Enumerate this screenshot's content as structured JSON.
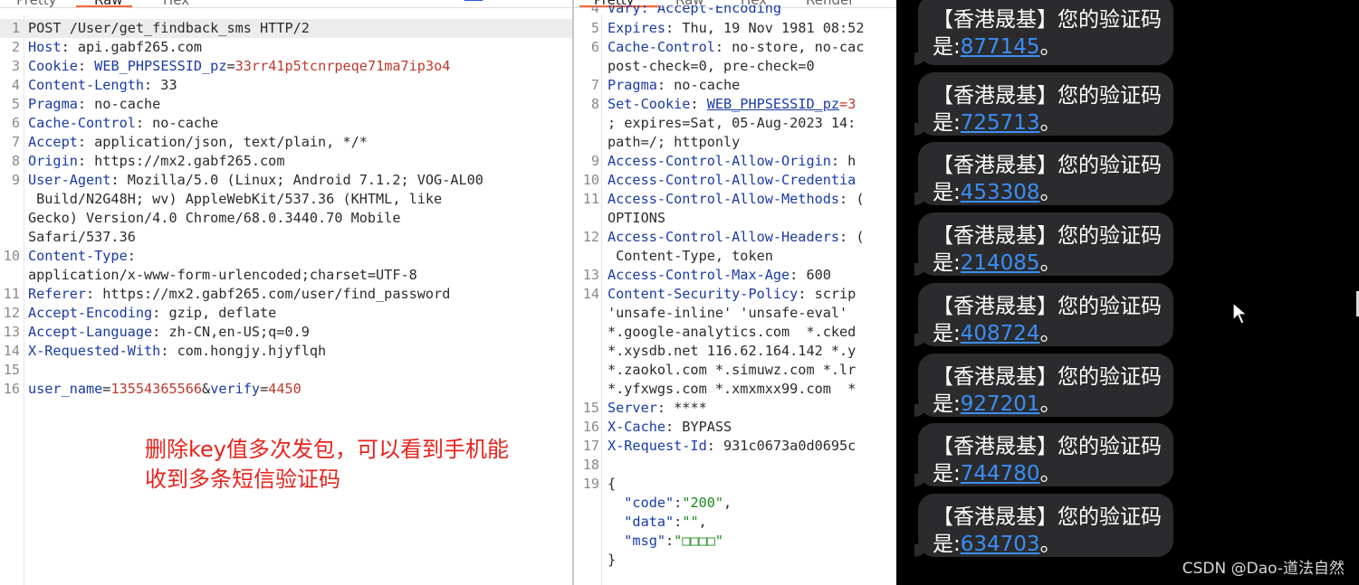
{
  "request": {
    "tabs": [
      "Pretty",
      "Raw",
      "Hex"
    ],
    "active_tab": "Raw",
    "top_icons": [
      "ln-icon",
      "wrap-icon",
      "menu-icon"
    ],
    "lines": [
      {
        "n": "1",
        "segs": [
          {
            "t": "POST /User/get_findback_sms HTTP/2",
            "c": "v"
          }
        ]
      },
      {
        "n": "2",
        "segs": [
          {
            "t": "Host",
            "c": "k"
          },
          {
            "t": ": api.gabf265.com",
            "c": "v"
          }
        ]
      },
      {
        "n": "3",
        "segs": [
          {
            "t": "Cookie",
            "c": "k"
          },
          {
            "t": ": ",
            "c": "v"
          },
          {
            "t": "WEB_PHPSESSID_pz",
            "c": "k"
          },
          {
            "t": "=",
            "c": "v"
          },
          {
            "t": "33rr41p5tcnrpeqe71ma7ip3o4",
            "c": "red"
          }
        ]
      },
      {
        "n": "4",
        "segs": [
          {
            "t": "Content-Length",
            "c": "k"
          },
          {
            "t": ": 33",
            "c": "v"
          }
        ]
      },
      {
        "n": "5",
        "segs": [
          {
            "t": "Pragma",
            "c": "k"
          },
          {
            "t": ": no-cache",
            "c": "v"
          }
        ]
      },
      {
        "n": "6",
        "segs": [
          {
            "t": "Cache-Control",
            "c": "k"
          },
          {
            "t": ": no-cache",
            "c": "v"
          }
        ]
      },
      {
        "n": "7",
        "segs": [
          {
            "t": "Accept",
            "c": "k"
          },
          {
            "t": ": application/json, text/plain, */*",
            "c": "v"
          }
        ]
      },
      {
        "n": "8",
        "segs": [
          {
            "t": "Origin",
            "c": "k"
          },
          {
            "t": ": https://mx2.gabf265.com",
            "c": "v"
          }
        ]
      },
      {
        "n": "9",
        "segs": [
          {
            "t": "User-Agent",
            "c": "k"
          },
          {
            "t": ": Mozilla/5.0 (Linux; Android 7.1.2; VOG-AL00",
            "c": "v"
          }
        ]
      },
      {
        "n": "",
        "segs": [
          {
            "t": " Build/N2G48H; wv) AppleWebKit/537.36 (KHTML, like",
            "c": "v"
          }
        ]
      },
      {
        "n": "",
        "segs": [
          {
            "t": "Gecko) Version/4.0 Chrome/68.0.3440.70 Mobile",
            "c": "v"
          }
        ]
      },
      {
        "n": "",
        "segs": [
          {
            "t": "Safari/537.36",
            "c": "v"
          }
        ]
      },
      {
        "n": "10",
        "segs": [
          {
            "t": "Content-Type",
            "c": "k"
          },
          {
            "t": ":",
            "c": "v"
          }
        ]
      },
      {
        "n": "",
        "segs": [
          {
            "t": "application/x-www-form-urlencoded;charset=UTF-8",
            "c": "v"
          }
        ]
      },
      {
        "n": "11",
        "segs": [
          {
            "t": "Referer",
            "c": "k"
          },
          {
            "t": ": https://mx2.gabf265.com/user/find_password",
            "c": "v"
          }
        ]
      },
      {
        "n": "12",
        "segs": [
          {
            "t": "Accept-Encoding",
            "c": "k"
          },
          {
            "t": ": gzip, deflate",
            "c": "v"
          }
        ]
      },
      {
        "n": "13",
        "segs": [
          {
            "t": "Accept-Language",
            "c": "k"
          },
          {
            "t": ": zh-CN,en-US;q=0.9",
            "c": "v"
          }
        ]
      },
      {
        "n": "14",
        "segs": [
          {
            "t": "X-Requested-With",
            "c": "k"
          },
          {
            "t": ": com.hongjy.hjyflqh",
            "c": "v"
          }
        ]
      },
      {
        "n": "15",
        "segs": []
      },
      {
        "n": "16",
        "segs": [
          {
            "t": "user_name",
            "c": "k"
          },
          {
            "t": "=",
            "c": "v"
          },
          {
            "t": "13554365566",
            "c": "red"
          },
          {
            "t": "&",
            "c": "v"
          },
          {
            "t": "verify",
            "c": "k"
          },
          {
            "t": "=",
            "c": "v"
          },
          {
            "t": "4450",
            "c": "red"
          }
        ]
      }
    ],
    "annotation_line1": "删除key值多次发包，可以看到手机能",
    "annotation_line2": "收到多条短信验证码"
  },
  "response": {
    "tabs": [
      "Pretty",
      "Raw",
      "Hex",
      "Render"
    ],
    "active_tab": "Pretty",
    "top_partial": "Vary: Accept-Encoding",
    "lines": [
      {
        "n": "5",
        "segs": [
          {
            "t": "Expires",
            "c": "k"
          },
          {
            "t": ": Thu, 19 Nov 1981 08:52",
            "c": "v"
          }
        ]
      },
      {
        "n": "6",
        "segs": [
          {
            "t": "Cache-Control",
            "c": "k"
          },
          {
            "t": ": no-store, no-cac",
            "c": "v"
          }
        ]
      },
      {
        "n": "",
        "segs": [
          {
            "t": "post-check=0, pre-check=0",
            "c": "v"
          }
        ]
      },
      {
        "n": "7",
        "segs": [
          {
            "t": "Pragma",
            "c": "k"
          },
          {
            "t": ": no-cache",
            "c": "v"
          }
        ]
      },
      {
        "n": "8",
        "segs": [
          {
            "t": "Set-Cookie",
            "c": "k"
          },
          {
            "t": ": ",
            "c": "v"
          },
          {
            "t": "WEB_PHPSESSID_pz",
            "c": "k ul"
          },
          {
            "t": "=3",
            "c": "red"
          }
        ]
      },
      {
        "n": "",
        "segs": [
          {
            "t": "; expires=Sat, 05-Aug-2023 14:",
            "c": "v"
          }
        ]
      },
      {
        "n": "",
        "segs": [
          {
            "t": "path=/; httponly",
            "c": "v"
          }
        ]
      },
      {
        "n": "9",
        "segs": [
          {
            "t": "Access-Control-Allow-Origin",
            "c": "k"
          },
          {
            "t": ": h",
            "c": "v"
          }
        ]
      },
      {
        "n": "10",
        "segs": [
          {
            "t": "Access-Control-Allow-Credentia",
            "c": "k"
          }
        ]
      },
      {
        "n": "11",
        "segs": [
          {
            "t": "Access-Control-Allow-Methods",
            "c": "k"
          },
          {
            "t": ": (",
            "c": "v"
          }
        ]
      },
      {
        "n": "",
        "segs": [
          {
            "t": "OPTIONS",
            "c": "v"
          }
        ]
      },
      {
        "n": "12",
        "segs": [
          {
            "t": "Access-Control-Allow-Headers",
            "c": "k"
          },
          {
            "t": ": (",
            "c": "v"
          }
        ]
      },
      {
        "n": "",
        "segs": [
          {
            "t": " Content-Type, token",
            "c": "v"
          }
        ]
      },
      {
        "n": "13",
        "segs": [
          {
            "t": "Access-Control-Max-Age",
            "c": "k"
          },
          {
            "t": ": 600",
            "c": "v"
          }
        ]
      },
      {
        "n": "14",
        "segs": [
          {
            "t": "Content-Security-Policy",
            "c": "k"
          },
          {
            "t": ": scrip",
            "c": "v"
          }
        ]
      },
      {
        "n": "",
        "segs": [
          {
            "t": "'unsafe-inline' 'unsafe-eval' ",
            "c": "v"
          }
        ]
      },
      {
        "n": "",
        "segs": [
          {
            "t": "*.google-analytics.com  *.cked",
            "c": "v"
          }
        ]
      },
      {
        "n": "",
        "segs": [
          {
            "t": "*.xysdb.net 116.62.164.142 *.y",
            "c": "v"
          }
        ]
      },
      {
        "n": "",
        "segs": [
          {
            "t": "*.zaokol.com *.simuwz.com *.lr",
            "c": "v"
          }
        ]
      },
      {
        "n": "",
        "segs": [
          {
            "t": "*.yfxwgs.com *.xmxmxx99.com  *",
            "c": "v"
          }
        ]
      },
      {
        "n": "15",
        "segs": [
          {
            "t": "Server",
            "c": "k"
          },
          {
            "t": ": ****",
            "c": "v"
          }
        ]
      },
      {
        "n": "16",
        "segs": [
          {
            "t": "X-Cache",
            "c": "k"
          },
          {
            "t": ": BYPASS",
            "c": "v"
          }
        ]
      },
      {
        "n": "17",
        "segs": [
          {
            "t": "X-Request-Id",
            "c": "k"
          },
          {
            "t": ": 931c0673a0d0695c",
            "c": "v"
          }
        ]
      },
      {
        "n": "18",
        "segs": []
      },
      {
        "n": "19",
        "segs": [
          {
            "t": "{",
            "c": "v"
          }
        ]
      },
      {
        "n": "",
        "segs": [
          {
            "t": "  \"code\"",
            "c": "k"
          },
          {
            "t": ":",
            "c": "v"
          },
          {
            "t": "\"200\"",
            "c": "grn"
          },
          {
            "t": ",",
            "c": "v"
          }
        ]
      },
      {
        "n": "",
        "segs": [
          {
            "t": "  \"data\"",
            "c": "k"
          },
          {
            "t": ":",
            "c": "v"
          },
          {
            "t": "\"\"",
            "c": "grn"
          },
          {
            "t": ",",
            "c": "v"
          }
        ]
      },
      {
        "n": "",
        "segs": [
          {
            "t": "  \"msg\"",
            "c": "k"
          },
          {
            "t": ":",
            "c": "v"
          },
          {
            "t": "\"□□□□\"",
            "c": "grn"
          }
        ]
      },
      {
        "n": "",
        "segs": [
          {
            "t": "}",
            "c": "v"
          }
        ]
      }
    ]
  },
  "sms": {
    "line1": "【香港晟基】您的验证码",
    "prefix": "是:",
    "suffix": "。",
    "codes": [
      "877145",
      "725713",
      "453308",
      "214085",
      "408724",
      "927201",
      "744780",
      "634703"
    ]
  },
  "watermark": "CSDN @Dao-道法自然",
  "colors": {
    "key": "#1a3aa8",
    "value_red": "#c0392b",
    "json_string": "#1a8a1a",
    "annotation": "#e8231c",
    "sms_link": "#3b8ef5",
    "tab_underline": "#ff6633"
  }
}
